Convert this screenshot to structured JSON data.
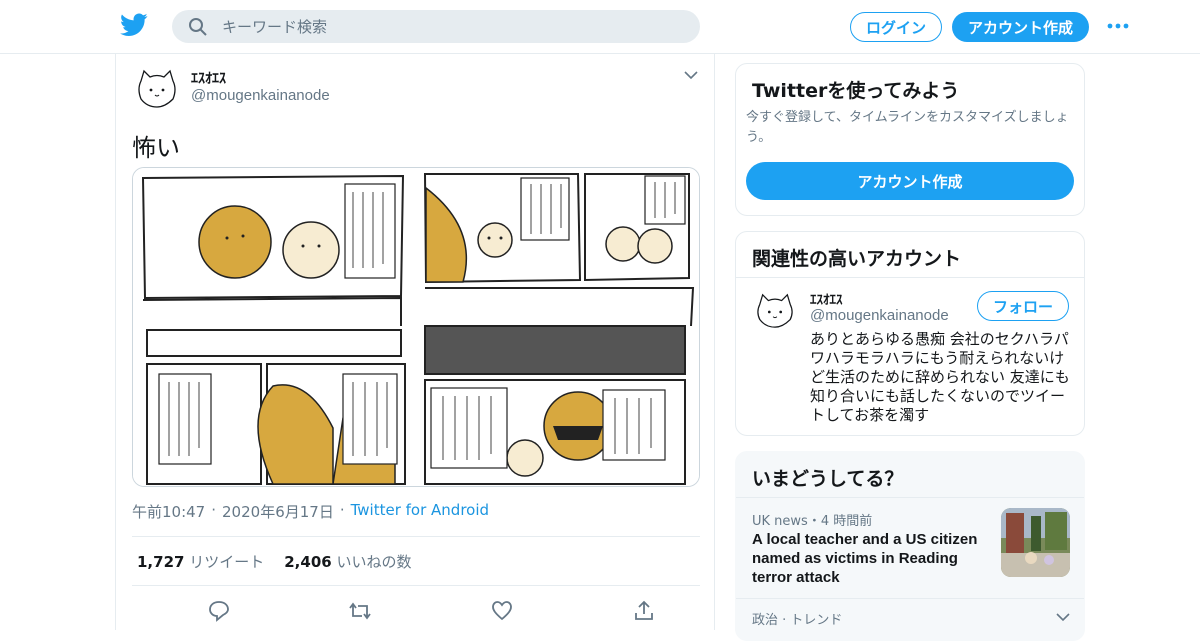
{
  "header": {
    "search_placeholder": "キーワード検索",
    "login_label": "ログイン",
    "signup_label": "アカウント作成"
  },
  "tweet": {
    "display_name": "ｴｽｵｴｽ",
    "handle": "@mougenkainanode",
    "text": "怖い",
    "time": "午前10:47",
    "date": "2020年6月17日",
    "source": "Twitter for Android",
    "retweets": "1,727",
    "retweets_label": "リツイート",
    "likes": "2,406",
    "likes_label": "いいねの数"
  },
  "sidebar": {
    "try_title": "Twitterを使ってみよう",
    "try_desc": "今すぐ登録して、タイムラインをカスタマイズしましょう。",
    "try_button": "アカウント作成",
    "related_title": "関連性の高いアカウント",
    "related": {
      "name": "ｴｽｵｴｽ",
      "handle": "@mougenkainanode",
      "follow_label": "フォロー",
      "bio": "ありとあらゆる愚痴 会社のセクハラパワハラモラハラにもう耐えられないけど生活のために辞められない 友達にも知り合いにも話したくないのでツイートしてお茶を濁す"
    },
    "trends_title": "いまどうしてる？",
    "trends": [
      {
        "category": "UK news・4 時間前",
        "headline": "A local teacher and a US citizen named as victims in Reading terror attack"
      },
      {
        "category": "政治 · トレンド"
      }
    ]
  },
  "colors": {
    "accent": "#1da1f2",
    "muted": "#657786",
    "border": "#e6ecf0",
    "comic_blob": "#d7a83f"
  }
}
